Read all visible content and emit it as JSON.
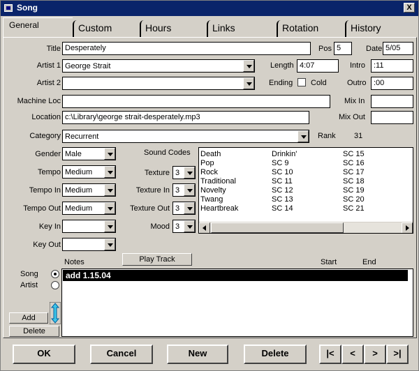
{
  "window": {
    "title": "Song",
    "close_label": "X"
  },
  "tabs": [
    "General",
    "Custom",
    "Hours",
    "Links",
    "Rotation",
    "History"
  ],
  "fields": {
    "title_label": "Title",
    "title": "Desperately",
    "pos_label": "Pos",
    "pos": "5",
    "date_label": "Date",
    "date": "5/05",
    "artist1_label": "Artist 1",
    "artist1": "George Strait",
    "length_label": "Length",
    "length": "4:07",
    "intro_label": "Intro",
    "intro": ":11",
    "artist2_label": "Artist 2",
    "artist2": "",
    "ending_label": "Ending",
    "cold_label": "Cold",
    "outro_label": "Outro",
    "outro": ":00",
    "machine_loc_label": "Machine Loc",
    "machine_loc": "",
    "mix_in_label": "Mix In",
    "mix_in": "",
    "location_label": "Location",
    "location": "c:\\Library\\george strait-desperately.mp3",
    "mix_out_label": "Mix Out",
    "mix_out": "",
    "category_label": "Category",
    "category": "Recurrent",
    "rank_label": "Rank",
    "rank": "31",
    "gender_label": "Gender",
    "gender": "Male",
    "tempo_label": "Tempo",
    "tempo": "Medium",
    "tempo_in_label": "Tempo In",
    "tempo_in": "Medium",
    "tempo_out_label": "Tempo Out",
    "tempo_out": "Medium",
    "key_in_label": "Key In",
    "key_in": "",
    "key_out_label": "Key Out",
    "key_out": "",
    "sound_codes_label": "Sound Codes",
    "texture_label": "Texture",
    "texture": "3",
    "texture_in_label": "Texture In",
    "texture_in": "3",
    "texture_out_label": "Texture Out",
    "texture_out": "3",
    "mood_label": "Mood",
    "mood": "3"
  },
  "sound_codes": {
    "col1": [
      "Death",
      "Pop",
      "Rock",
      "Traditional",
      "Novelty",
      "Twang",
      "Heartbreak"
    ],
    "col2": [
      "Drinkin'",
      "SC 9",
      "SC 10",
      "SC 11",
      "SC 12",
      "SC 13",
      "SC 14"
    ],
    "col3": [
      "SC 15",
      "SC 16",
      "SC 17",
      "SC 18",
      "SC 19",
      "SC 20",
      "SC 21"
    ]
  },
  "notes": {
    "label": "Notes",
    "play_track": "Play Track",
    "start_label": "Start",
    "end_label": "End",
    "song_label": "Song",
    "artist_label": "Artist",
    "add_label": "Add",
    "delete_label": "Delete",
    "entries": [
      "add 1.15.04"
    ]
  },
  "buttons": {
    "ok": "OK",
    "cancel": "Cancel",
    "new": "New",
    "delete": "Delete",
    "first": "|<",
    "prev": "<",
    "next": ">",
    "last": ">|"
  },
  "colors": {
    "titlebar": "#0a246a",
    "face": "#d4d0c8",
    "selection": "#000000"
  }
}
